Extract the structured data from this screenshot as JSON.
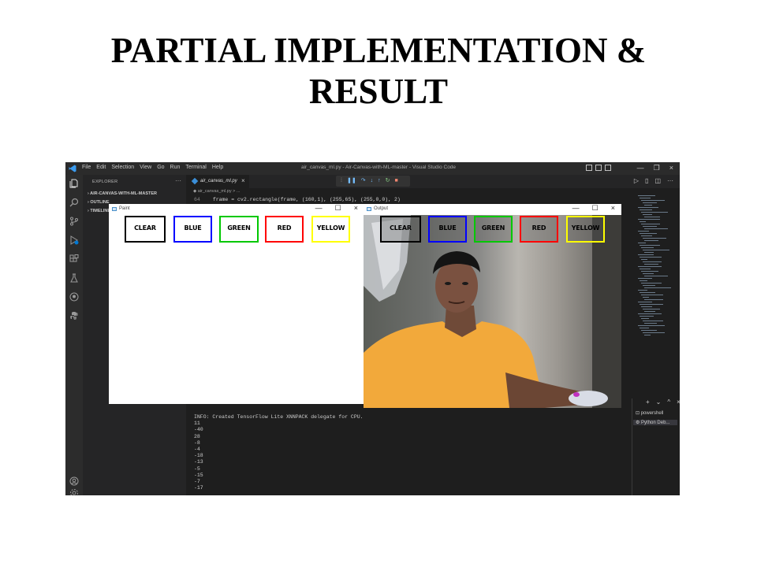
{
  "slide": {
    "title_line1": "PARTIAL IMPLEMENTATION &",
    "title_line2": "RESULT"
  },
  "vscode": {
    "menu": [
      "File",
      "Edit",
      "Selection",
      "View",
      "Go",
      "Run",
      "Terminal",
      "Help"
    ],
    "window_title": "air_canvas_ml.py - Air-Canvas-with-ML-master - Visual Studio Code",
    "sidebar": {
      "header": "EXPLORER",
      "more": "···",
      "items": [
        "AIR-CANVAS-WITH-ML-MASTER",
        "OUTLINE",
        "TIMELINE"
      ]
    },
    "tab": {
      "label": "air_canvas_ml.py",
      "close": "×"
    },
    "breadcrumb": "air_canvas_ml.py > ...",
    "code": {
      "line_number": "64",
      "line_code": "frame = cv2.rectangle(frame, (160,1), (255,65), (255,0,0), 2)"
    },
    "terminal": {
      "lines": [
        "INFO: Created TensorFlow Lite XNNPACK delegate for CPU.",
        "11",
        "-40",
        "28",
        "-8",
        "-4",
        "-18",
        "-13",
        "-5",
        "-15",
        "-7",
        "-17"
      ],
      "sessions": [
        "powershell",
        "Python Deb..."
      ],
      "controls": [
        "+",
        "⌄",
        "^",
        "×"
      ]
    },
    "colors": {
      "bg": "#1e1e1e",
      "sidebar": "#252526",
      "activity": "#2c2c2c",
      "accent": "#0078d4"
    }
  },
  "paint_window": {
    "title": "Paint",
    "controls": [
      "—",
      "☐",
      "×"
    ],
    "buttons": [
      {
        "label": "CLEAR",
        "color": "#000000"
      },
      {
        "label": "BLUE",
        "color": "#0000ff"
      },
      {
        "label": "GREEN",
        "color": "#00c800"
      },
      {
        "label": "RED",
        "color": "#ff0000"
      },
      {
        "label": "YELLOW",
        "color": "#ffff00"
      }
    ]
  },
  "output_window": {
    "title": "Output",
    "controls": [
      "—",
      "☐",
      "×"
    ],
    "buttons": [
      {
        "label": "CLEAR",
        "color": "#000000"
      },
      {
        "label": "BLUE",
        "color": "#0000ff"
      },
      {
        "label": "GREEN",
        "color": "#00c800"
      },
      {
        "label": "RED",
        "color": "#ff0000"
      },
      {
        "label": "YELLOW",
        "color": "#ffff00"
      }
    ]
  }
}
